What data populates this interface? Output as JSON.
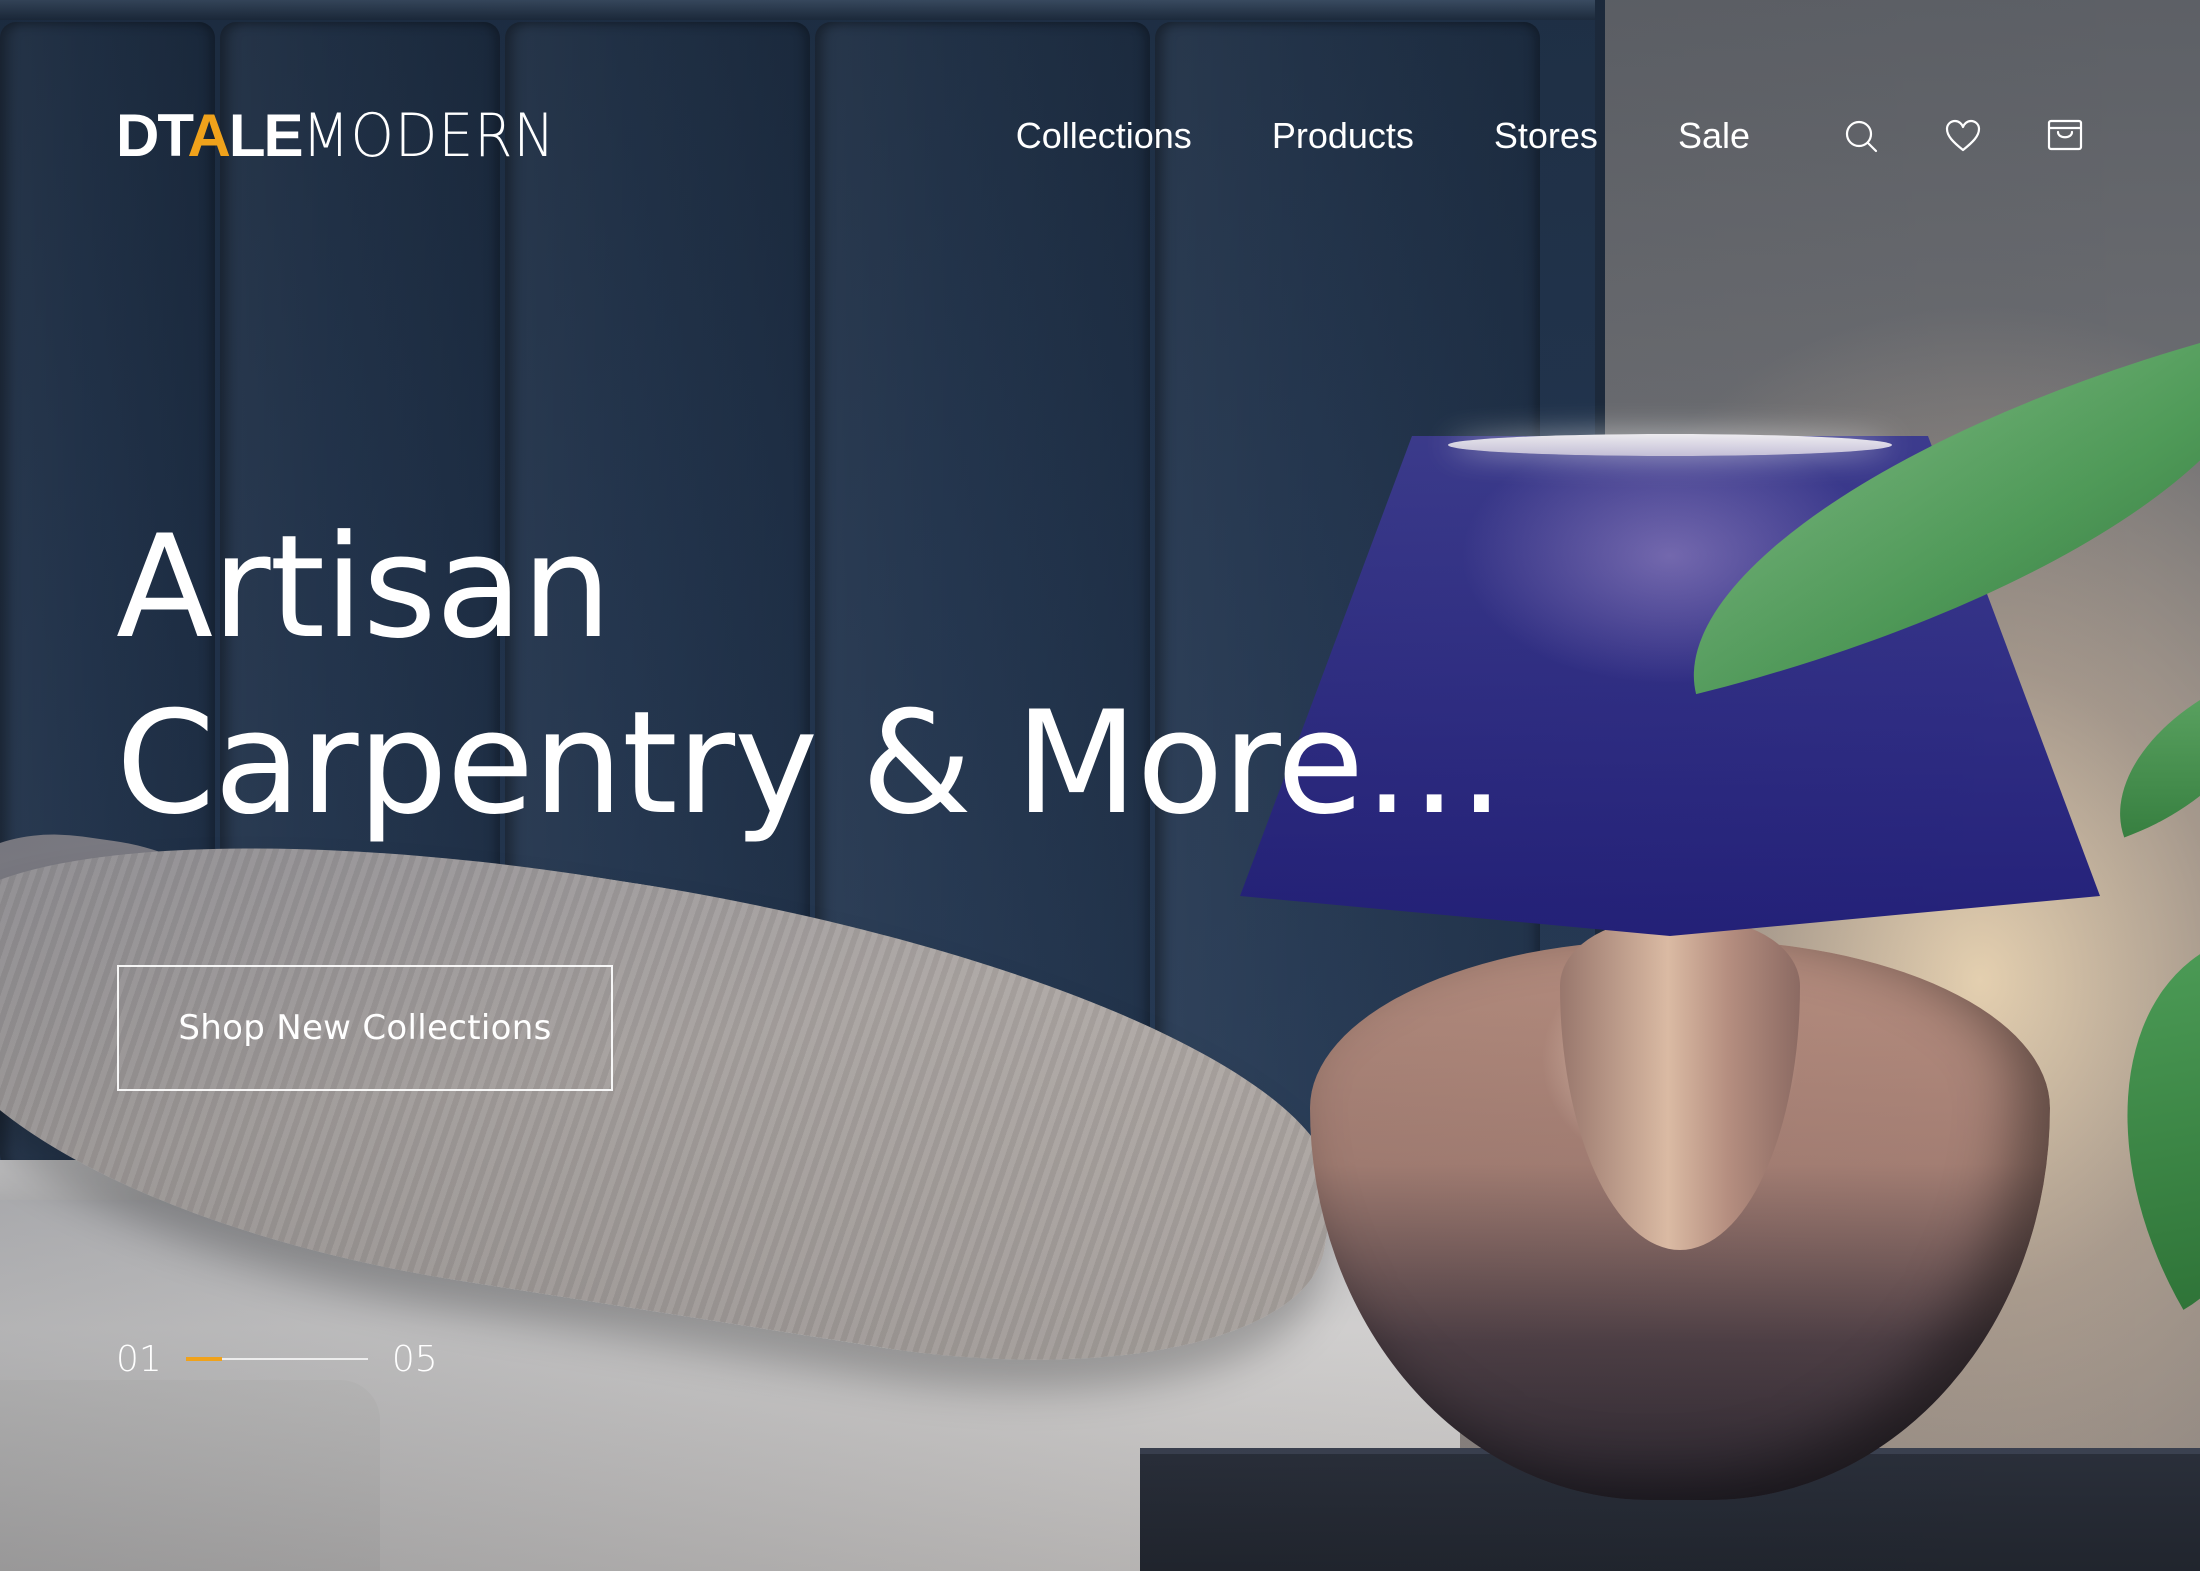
{
  "brand": {
    "logo_strong_prefix": "DT",
    "logo_strong_accent": "A",
    "logo_strong_suffix": "LE",
    "logo_light": "MODERN",
    "accent_color": "#f0a21b"
  },
  "nav": {
    "items": [
      {
        "label": "Collections"
      },
      {
        "label": "Products"
      },
      {
        "label": "Stores"
      },
      {
        "label": "Sale"
      }
    ],
    "icons": [
      "search-icon",
      "heart-icon",
      "shopping-bag-icon"
    ]
  },
  "hero": {
    "headline_line1": "Artisan",
    "headline_line2": "Carpentry & More…",
    "cta_label": "Shop New Collections"
  },
  "slider": {
    "current": "01",
    "total": "05",
    "progress": 0.2
  }
}
